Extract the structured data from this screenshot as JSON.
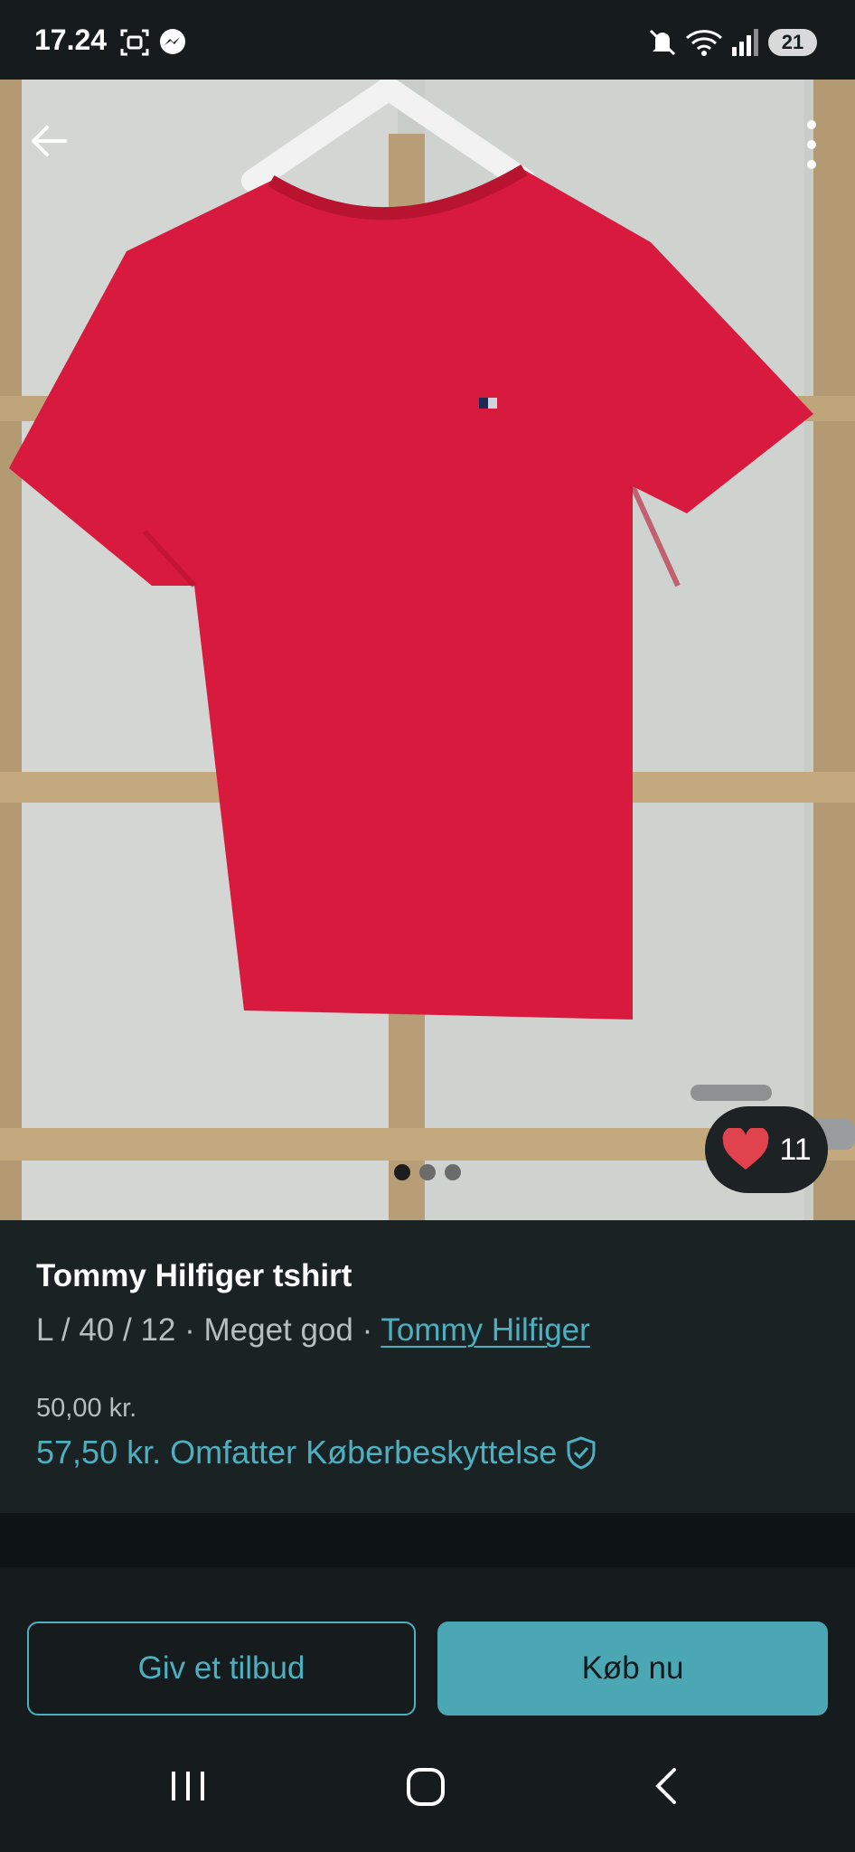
{
  "status_bar": {
    "time": "17.24",
    "battery": "21",
    "icons": [
      "screenshot-icon",
      "messenger-icon",
      "mute-icon",
      "wifi-icon",
      "signal-icon"
    ]
  },
  "listing": {
    "title": "Tommy Hilfiger tshirt",
    "size": "L / 40 / 12",
    "separator": "·",
    "condition": "Meget god",
    "brand": "Tommy Hilfiger",
    "price": "50,00 kr.",
    "total_price": "57,50 kr.",
    "protection_text": "Omfatter Køberbeskyttelse",
    "favorites": "11",
    "photo_count": 3,
    "active_photo": 0
  },
  "actions": {
    "offer_label": "Giv et tilbud",
    "buy_label": "Køb nu"
  },
  "colors": {
    "accent": "#4db0c0",
    "background": "#161c1e",
    "shirt": "#d81a3e",
    "heart": "#e0434d"
  }
}
